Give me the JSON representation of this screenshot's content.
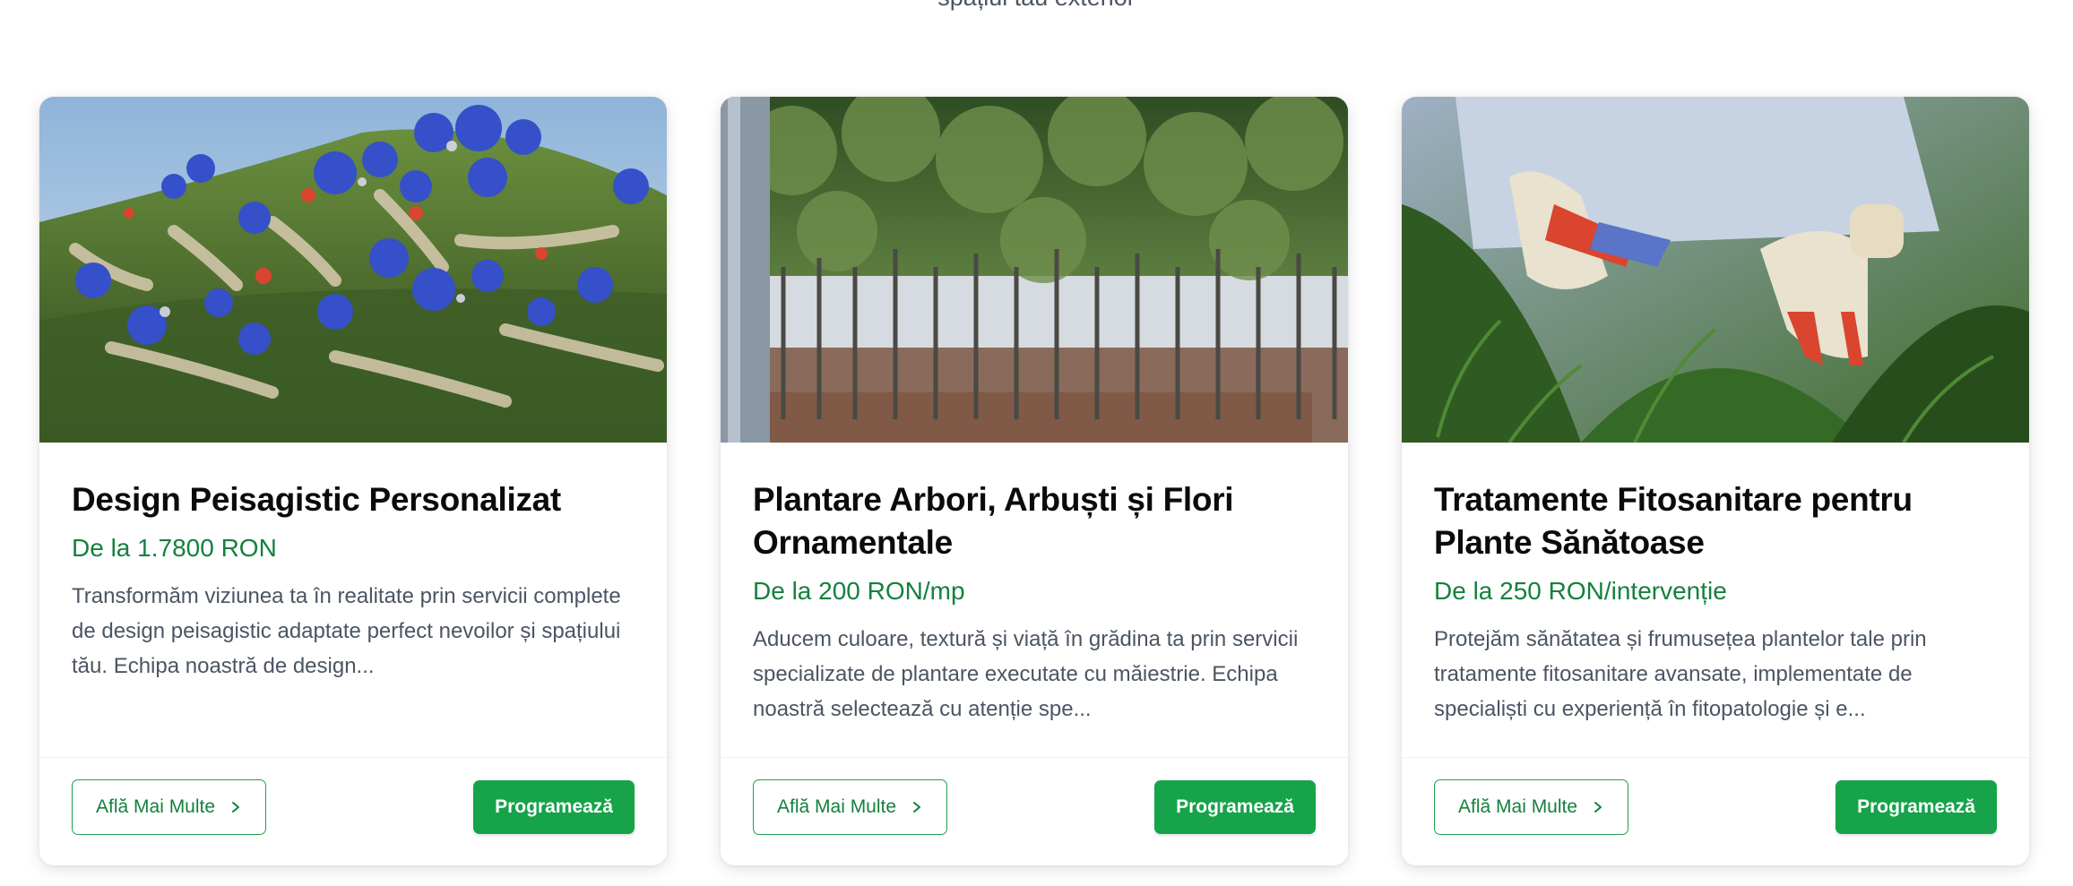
{
  "header": {
    "subtitle_fragment": "spațiul tău exterior"
  },
  "colors": {
    "accent": "#16a34a",
    "price": "#15803d",
    "text_muted": "#4b5563"
  },
  "cards": [
    {
      "image_icon": "landscape-hill-flowers-image",
      "title": "Design Peisagistic Personalizat",
      "price": "De la 1.7800 RON",
      "description": "Transformăm viziunea ta în realitate prin servicii complete de design peisagistic adaptate perfect nevoilor și spațiului tău. Echipa noastră de design...",
      "learn_more": "Află Mai Multe",
      "book": "Programează"
    },
    {
      "image_icon": "trees-nursery-image",
      "title": "Plantare Arbori, Arbuști și Flori Ornamentale",
      "price": "De la 200 RON/mp",
      "description": "Aducem culoare, textură și viață în grădina ta prin servicii specializate de plantare executate cu măiestrie. Echipa noastră selectează cu atenție spe...",
      "learn_more": "Află Mai Multe",
      "book": "Programează"
    },
    {
      "image_icon": "gloved-hands-spraying-plants-image",
      "title": "Tratamente Fitosanitare pentru Plante Sănătoase",
      "price": "De la 250 RON/intervenție",
      "description": "Protejăm sănătatea și frumusețea plantelor tale prin tratamente fitosanitare avansate, implementate de specialiști cu experiență în fitopatologie și e...",
      "learn_more": "Află Mai Multe",
      "book": "Programează"
    }
  ]
}
